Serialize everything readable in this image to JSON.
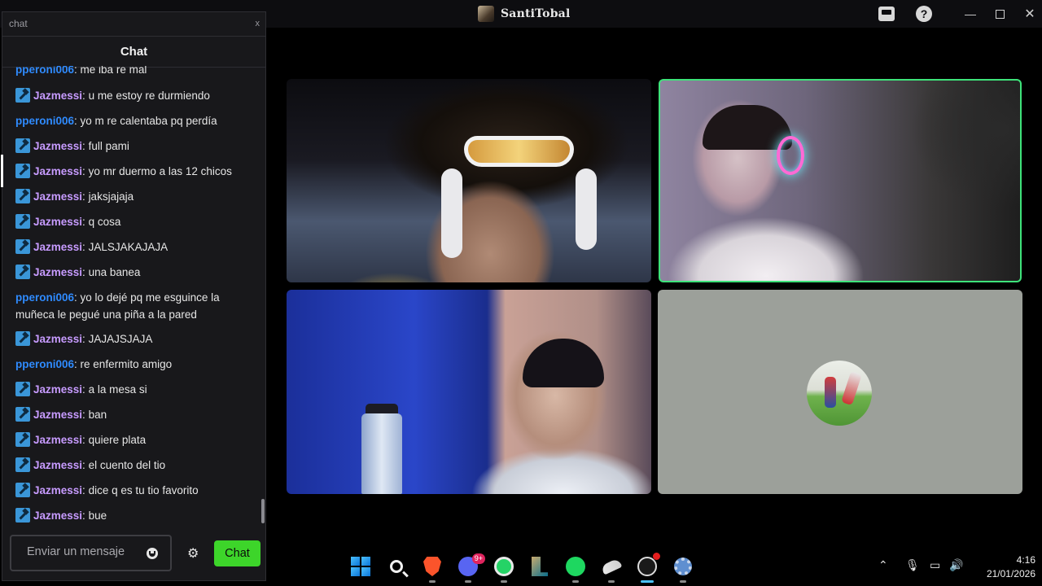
{
  "window": {
    "title": "SantiTobal",
    "controls": {
      "minimize": "—",
      "maximize": "",
      "close": "✕"
    }
  },
  "chat": {
    "search_value": "chat",
    "close_glyph": "x",
    "title": "Chat",
    "messages": [
      {
        "user": "pperoni006",
        "role": "pep",
        "badge": false,
        "text": "me iba re mal"
      },
      {
        "user": "Jazmessi",
        "role": "jaz",
        "badge": true,
        "text": "u me estoy re durmiendo"
      },
      {
        "user": "pperoni006",
        "role": "pep",
        "badge": false,
        "text": "yo m re calentaba pq perdía"
      },
      {
        "user": "Jazmessi",
        "role": "jaz",
        "badge": true,
        "text": "full pami"
      },
      {
        "user": "Jazmessi",
        "role": "jaz",
        "badge": true,
        "text": "yo mr duermo a las 12 chicos"
      },
      {
        "user": "Jazmessi",
        "role": "jaz",
        "badge": true,
        "text": "jaksjajaja"
      },
      {
        "user": "Jazmessi",
        "role": "jaz",
        "badge": true,
        "text": "q cosa"
      },
      {
        "user": "Jazmessi",
        "role": "jaz",
        "badge": true,
        "text": "JALSJAKAJAJA"
      },
      {
        "user": "Jazmessi",
        "role": "jaz",
        "badge": true,
        "text": "una banea"
      },
      {
        "user": "pperoni006",
        "role": "pep",
        "badge": false,
        "text": "yo lo dejé pq me esguince la muñeca le pegué una piña a la pared"
      },
      {
        "user": "Jazmessi",
        "role": "jaz",
        "badge": true,
        "text": "JAJAJSJAJA"
      },
      {
        "user": "pperoni006",
        "role": "pep",
        "badge": false,
        "text": "re enfermito amigo"
      },
      {
        "user": "Jazmessi",
        "role": "jaz",
        "badge": true,
        "text": "a la mesa si"
      },
      {
        "user": "Jazmessi",
        "role": "jaz",
        "badge": true,
        "text": "ban"
      },
      {
        "user": "Jazmessi",
        "role": "jaz",
        "badge": true,
        "text": "quiere plata"
      },
      {
        "user": "Jazmessi",
        "role": "jaz",
        "badge": true,
        "text": "el cuento del tio"
      },
      {
        "user": "Jazmessi",
        "role": "jaz",
        "badge": true,
        "text": "dice q es tu tio favorito"
      },
      {
        "user": "Jazmessi",
        "role": "jaz",
        "badge": true,
        "text": "bue"
      }
    ],
    "input_placeholder": "Enviar un mensaje",
    "send_label": "Chat",
    "settings_glyph": "⚙"
  },
  "taskbar": {
    "apps": [
      "windows-start",
      "search",
      "brave",
      "discord",
      "whatsapp",
      "league-of-legends",
      "spotify",
      "app",
      "obs",
      "settings"
    ],
    "discord_badge": "9+",
    "tray": {
      "chevron": "⌃",
      "mic": "🎙",
      "network": "▭",
      "volume": "🔊"
    },
    "clock": {
      "time": "4:16",
      "date": "21/01/2026"
    }
  },
  "colors": {
    "chat_bg": "#18181b",
    "jazmessi": "#c79bff",
    "pperoni": "#2f8bff",
    "send_button": "#3dd52a",
    "active_speaker_border": "#3ee37a"
  }
}
